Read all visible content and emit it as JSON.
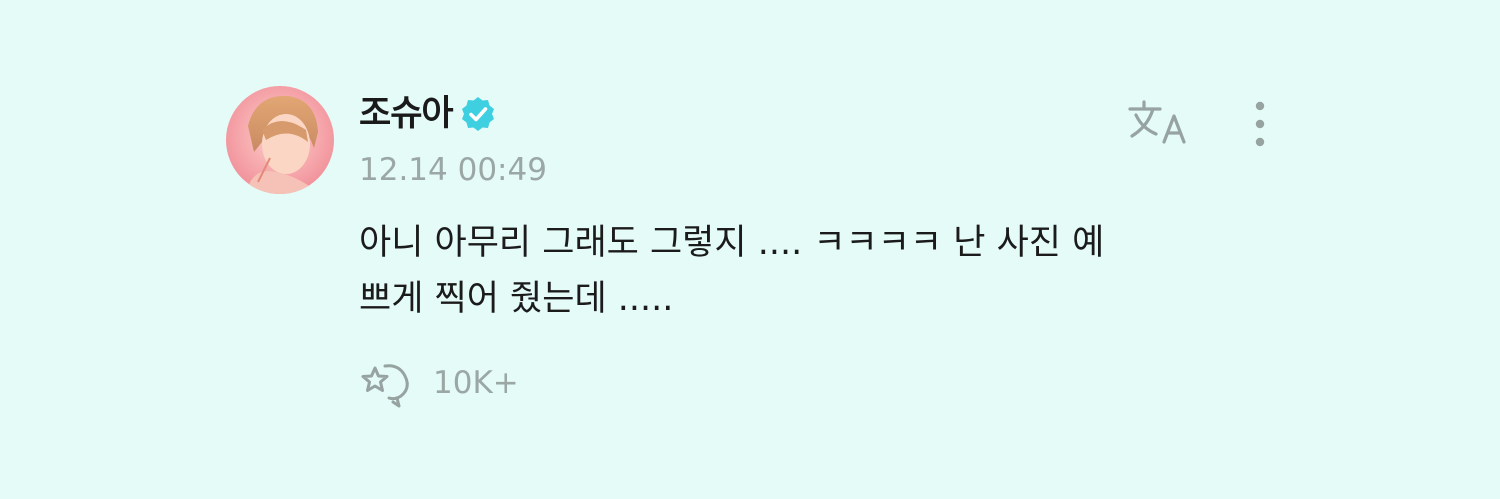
{
  "post": {
    "author": "조슈아",
    "verified": true,
    "timestamp": "12.14 00:49",
    "message": "아니 아무리 그래도 그렇지 .... ㅋㅋㅋㅋ 난 사진 예\n쁘게 찍어 줬는데 .....",
    "reaction_count": "10K+"
  },
  "icons": {
    "verified": "verified-badge-icon",
    "translate": "translate-icon",
    "more": "more-vertical-icon",
    "reaction": "star-reaction-icon"
  },
  "colors": {
    "background": "#e4fbf8",
    "verified_badge": "#3ecfe0",
    "muted_text": "#9aa7a5",
    "icon": "#96a3a1"
  }
}
